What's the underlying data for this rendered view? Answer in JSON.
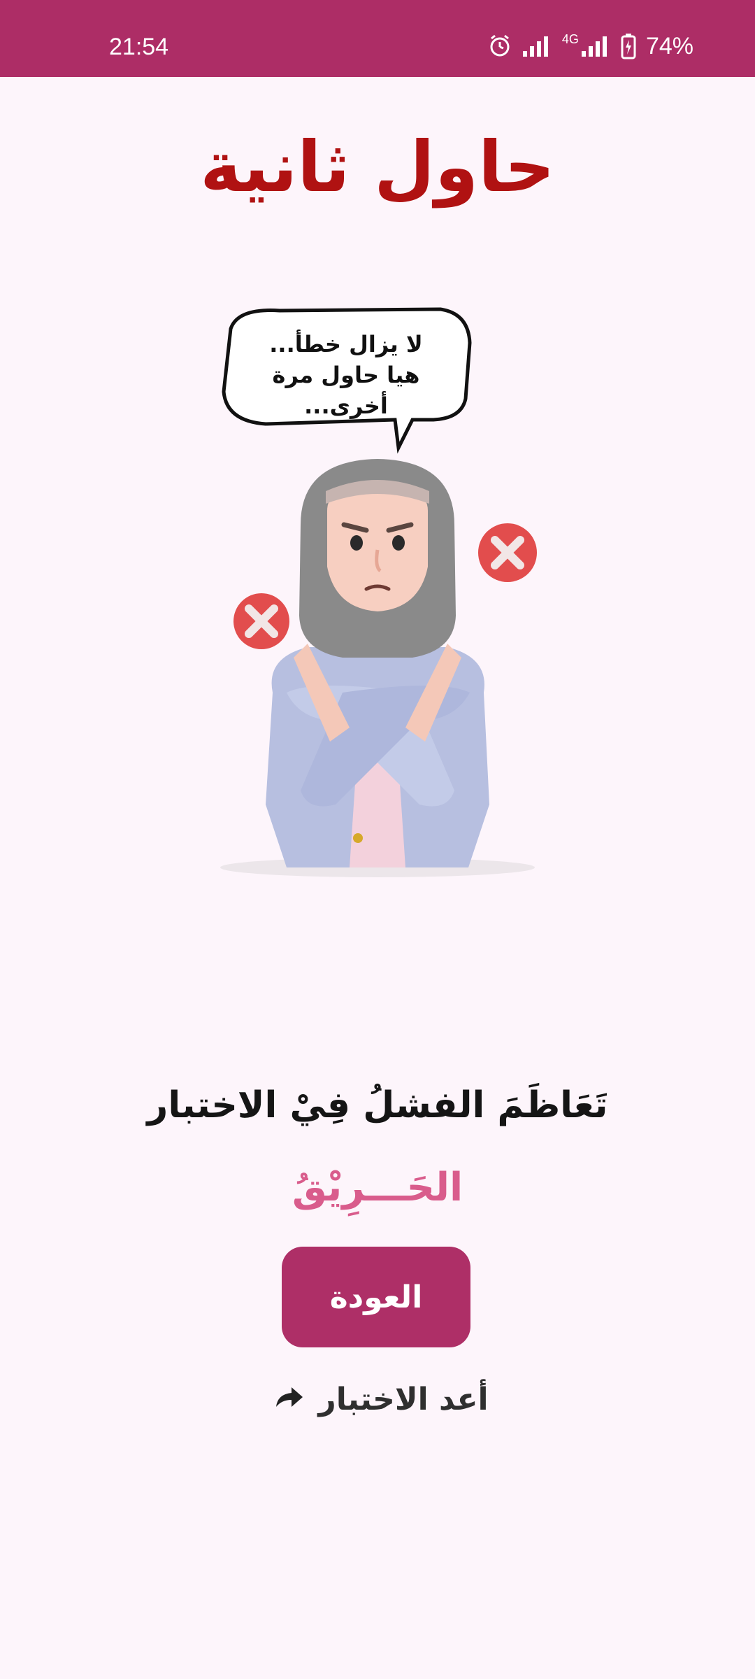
{
  "status_bar": {
    "time": "21:54",
    "network": "4G",
    "battery": "74%",
    "icons": [
      "alarm-icon",
      "signal-icon",
      "network-4g-icon",
      "battery-charging-icon"
    ]
  },
  "page": {
    "title": "حاول ثانية",
    "speech_bubble": "لا يزال خطأ...\nهيا حاول مرة أخرى...",
    "main_message": "تَعَاظَمَ الفشلُ فِيْ الاختبار",
    "sub_message": "الحَـــرِيْقُ",
    "back_button": "العودة",
    "retry_link": "أعد الاختبار"
  },
  "colors": {
    "status_bar": "#ad2d66",
    "title": "#b01212",
    "accent_pink": "#d95c8c",
    "button": "#ae2f67",
    "background": "#fdf5fb"
  }
}
